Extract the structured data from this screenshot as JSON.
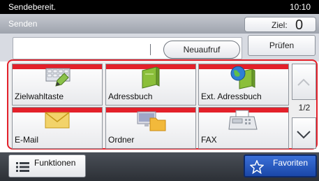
{
  "status": {
    "message": "Sendebereit.",
    "time": "10:10"
  },
  "header": {
    "title": "Senden"
  },
  "destination": {
    "label": "Ziel:",
    "count": "0"
  },
  "buttons": {
    "recall": "Neuaufruf",
    "check": "Prüfen"
  },
  "tiles": [
    {
      "label": "Zielwahltaste",
      "icon": "one-touch-key-icon"
    },
    {
      "label": "Adressbuch",
      "icon": "address-book-icon"
    },
    {
      "label": "Ext. Adressbuch",
      "icon": "external-address-book-icon"
    },
    {
      "label": "E-Mail",
      "icon": "email-icon"
    },
    {
      "label": "Ordner",
      "icon": "folder-icon"
    },
    {
      "label": "FAX",
      "icon": "fax-icon"
    }
  ],
  "pager": {
    "page": "1/2"
  },
  "footer": {
    "functions": "Funktionen",
    "favorites": "Favoriten"
  },
  "colors": {
    "accent": "#e3202a",
    "favorites": "#2a5bc4",
    "status_bar": "#000000"
  }
}
